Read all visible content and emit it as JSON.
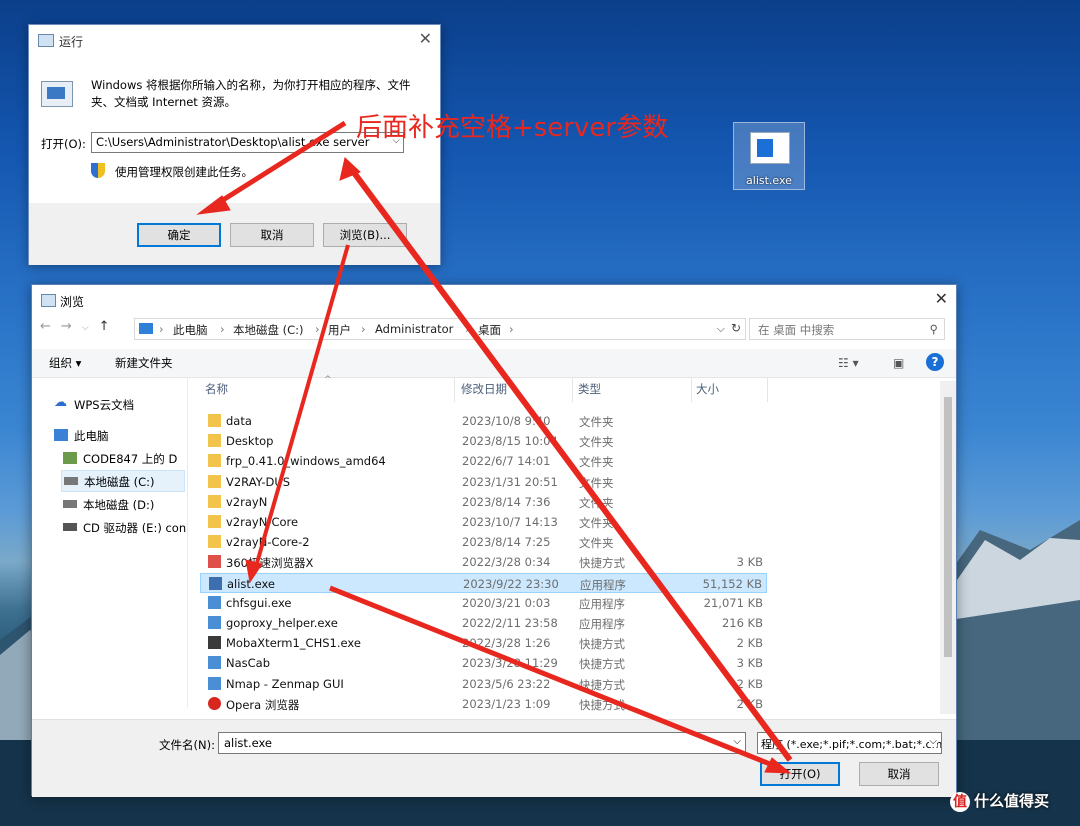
{
  "desktop": {
    "icon_label": "alist.exe",
    "watermark": "什么值得买",
    "watermark_logo": "值"
  },
  "annotation": "后面补充空格+server参数",
  "run": {
    "title": "运行",
    "description": "Windows 将根据你所输入的名称，为你打开相应的程序、文件夹、文档或 Internet 资源。",
    "open_label": "打开(O):",
    "command": "C:\\Users\\Administrator\\Desktop\\alist.exe server",
    "admin_text": "使用管理权限创建此任务。",
    "ok": "确定",
    "cancel": "取消",
    "browse": "浏览(B)..."
  },
  "browse": {
    "title": "浏览",
    "breadcrumb": [
      "此电脑",
      "本地磁盘 (C:)",
      "用户",
      "Administrator",
      "桌面"
    ],
    "search_placeholder": "在 桌面 中搜索",
    "organize": "组织 ▾",
    "new_folder": "新建文件夹",
    "sidebar": [
      {
        "label": "WPS云文档",
        "icon": "cloud-icon"
      },
      {
        "label": "此电脑",
        "icon": "computer-icon"
      },
      {
        "label": "CODE847 上的 D",
        "icon": "network-drive-icon"
      },
      {
        "label": "本地磁盘 (C:)",
        "icon": "drive-icon"
      },
      {
        "label": "本地磁盘 (D:)",
        "icon": "drive-icon"
      },
      {
        "label": "CD 驱动器 (E:) con",
        "icon": "cd-drive-icon"
      }
    ],
    "columns": {
      "name": "名称",
      "date": "修改日期",
      "type": "类型",
      "size": "大小"
    },
    "files": [
      {
        "name": "data",
        "date": "2023/10/8 9:40",
        "type": "文件夹",
        "size": "",
        "icon": "folder-icon"
      },
      {
        "name": "Desktop",
        "date": "2023/8/15 10:04",
        "type": "文件夹",
        "size": "",
        "icon": "folder-icon"
      },
      {
        "name": "frp_0.41.0_windows_amd64",
        "date": "2022/6/7 14:01",
        "type": "文件夹",
        "size": "",
        "icon": "folder-icon"
      },
      {
        "name": "V2RAY-DUS",
        "date": "2023/1/31 20:51",
        "type": "文件夹",
        "size": "",
        "icon": "folder-icon"
      },
      {
        "name": "v2rayN",
        "date": "2023/8/14 7:36",
        "type": "文件夹",
        "size": "",
        "icon": "folder-icon"
      },
      {
        "name": "v2rayN-Core",
        "date": "2023/10/7 14:13",
        "type": "文件夹",
        "size": "",
        "icon": "folder-icon"
      },
      {
        "name": "v2rayN-Core-2",
        "date": "2023/8/14 7:25",
        "type": "文件夹",
        "size": "",
        "icon": "folder-icon"
      },
      {
        "name": "360极速浏览器X",
        "date": "2022/3/28 0:34",
        "type": "快捷方式",
        "size": "3 KB",
        "icon": "browser-icon"
      },
      {
        "name": "alist.exe",
        "date": "2023/9/22 23:30",
        "type": "应用程序",
        "size": "51,152 KB",
        "icon": "exe-icon",
        "selected": true
      },
      {
        "name": "chfsgui.exe",
        "date": "2020/3/21 0:03",
        "type": "应用程序",
        "size": "21,071 KB",
        "icon": "app-icon"
      },
      {
        "name": "goproxy_helper.exe",
        "date": "2022/2/11 23:58",
        "type": "应用程序",
        "size": "216 KB",
        "icon": "app-icon"
      },
      {
        "name": "MobaXterm1_CHS1.exe",
        "date": "2022/3/28 1:26",
        "type": "快捷方式",
        "size": "2 KB",
        "icon": "terminal-icon"
      },
      {
        "name": "NasCab",
        "date": "2023/3/28 11:29",
        "type": "快捷方式",
        "size": "3 KB",
        "icon": "app-icon"
      },
      {
        "name": "Nmap - Zenmap GUI",
        "date": "2023/5/6 23:22",
        "type": "快捷方式",
        "size": "2 KB",
        "icon": "app-icon"
      },
      {
        "name": "Opera 浏览器",
        "date": "2023/1/23 1:09",
        "type": "快捷方式",
        "size": "2 KB",
        "icon": "opera-icon"
      }
    ],
    "filename_label": "文件名(N):",
    "filename_value": "alist.exe",
    "filter": "程序 (*.exe;*.pif;*.com;*.bat;*.cmd)",
    "open": "打开(O)",
    "cancel": "取消"
  },
  "colors": {
    "annotation_red": "#e8281f",
    "selection_blue": "#cce8ff",
    "accent": "#0078d7"
  }
}
